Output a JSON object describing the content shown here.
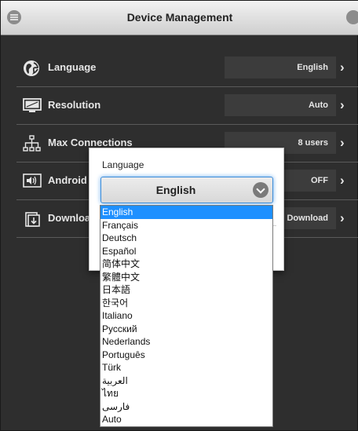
{
  "header": {
    "title": "Device Management",
    "menu_icon": "menu-icon",
    "profile_icon": "user-icon"
  },
  "settings": [
    {
      "label": "Language",
      "value": "English",
      "icon": "globe-icon"
    },
    {
      "label": "Resolution",
      "value": "Auto",
      "icon": "monitor-icon"
    },
    {
      "label": "Max Connections",
      "value": "8 users",
      "icon": "network-icon"
    },
    {
      "label": "Android",
      "value": "OFF",
      "icon": "speaker-icon"
    },
    {
      "label": "Downloa",
      "value": "Download",
      "icon": "download-icon"
    }
  ],
  "dialog": {
    "label": "Language",
    "selected": "English",
    "options": [
      "English",
      "Français",
      "Deutsch",
      "Español",
      "简体中文",
      "繁體中文",
      "日本語",
      "한국어",
      "Italiano",
      "Русский",
      "Nederlands",
      "Português",
      "Türk",
      "العربية",
      "ไทย",
      "فارسی",
      "Auto"
    ]
  },
  "colors": {
    "selection": "#1e90ff",
    "background": "#2e2e2e",
    "header": "#d9d9d9"
  }
}
